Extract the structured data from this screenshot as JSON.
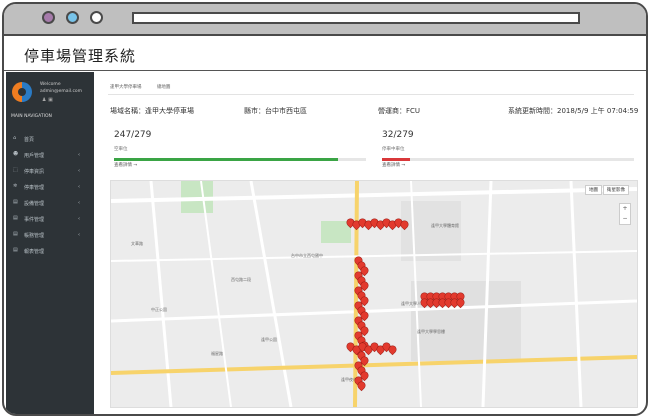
{
  "app_title": "停車場管理系統",
  "sidebar": {
    "welcome": "Welcome",
    "username": "admin@email.com",
    "nav_header": "MAIN NAVIGATION",
    "items": [
      {
        "icon": "home-icon",
        "label": "首頁",
        "chevron": ""
      },
      {
        "icon": "user-group-icon",
        "label": "用戶管理",
        "chevron": "‹"
      },
      {
        "icon": "car-icon",
        "label": "停車資訊",
        "chevron": "‹"
      },
      {
        "icon": "gear-icon",
        "label": "停車管理",
        "chevron": "‹"
      },
      {
        "icon": "document-icon",
        "label": "設備管理",
        "chevron": "‹"
      },
      {
        "icon": "document-icon",
        "label": "事件管理",
        "chevron": "‹"
      },
      {
        "icon": "document-icon",
        "label": "帳務管理",
        "chevron": "‹"
      },
      {
        "icon": "document-icon",
        "label": "報表管理",
        "chevron": ""
      }
    ]
  },
  "tabs": [
    "逢甲大學停車場",
    "總地圖"
  ],
  "info": {
    "site": "場域名稱：逢甲大學停車場",
    "district": "縣市：台中市西屯區",
    "operator": "營運商：FCU",
    "updated": "系統更新時間：2018/5/9 上午 07:04:59"
  },
  "stats": [
    {
      "value": "247/279",
      "label": "空車位",
      "more": "查看詳情 →",
      "fill_pct": 89,
      "color": "#3aa445"
    },
    {
      "value": "32/279",
      "label": "停車中車位",
      "more": "查看詳情 →",
      "fill_pct": 11,
      "color": "#d9383a"
    }
  ],
  "map": {
    "btn_map": "地圖",
    "btn_sat": "衛星影像",
    "zoom_in": "+",
    "zoom_out": "−",
    "labels": [
      "逢甲大學體育館",
      "逢甲大學人言大樓",
      "台中市立西屯國中",
      "西屯路二段",
      "逢甲夜市",
      "文華路",
      "福星路",
      "逢甲大學學思樓",
      "中正公園",
      "逢甲公園"
    ]
  }
}
